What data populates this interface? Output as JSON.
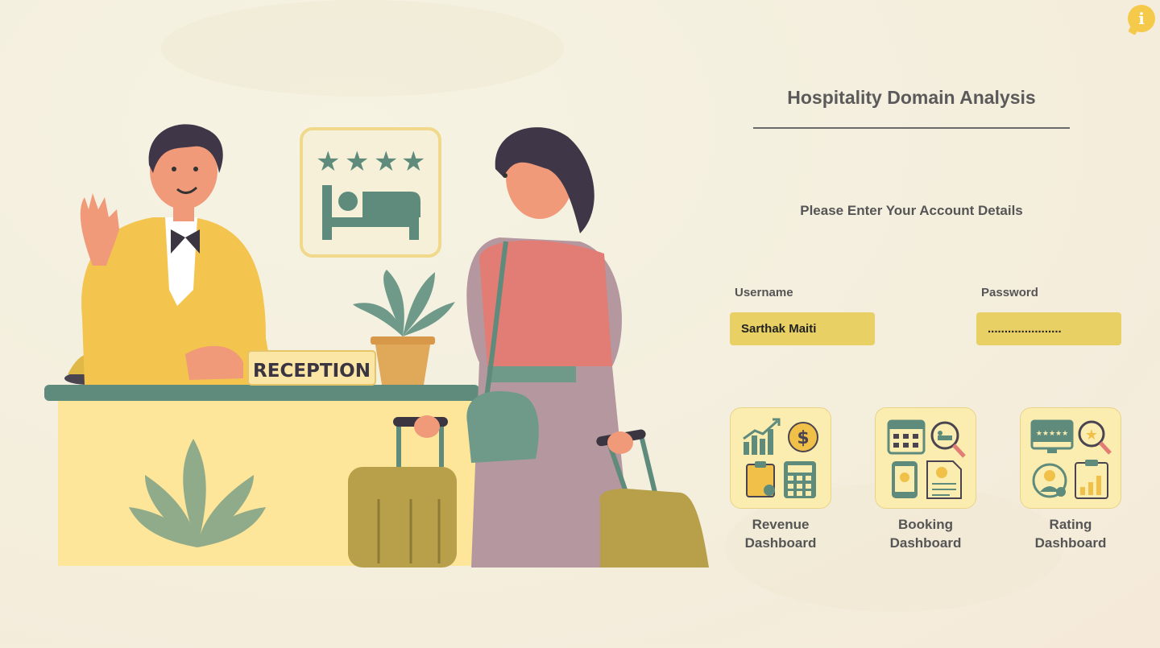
{
  "info": {
    "icon": "info-icon",
    "glyph": "i"
  },
  "illustration": {
    "sign_text": "RECEPTION"
  },
  "header": {
    "title": "Hospitality Domain Analysis",
    "subtitle": "Please Enter Your Account Details"
  },
  "form": {
    "username_label": "Username",
    "username_value": "Sarthak Maiti",
    "password_label": "Password",
    "password_value": "......................"
  },
  "dashboards": [
    {
      "line1": "Revenue",
      "line2": "Dashboard",
      "icon": "revenue-dashboard-icon"
    },
    {
      "line1": "Booking",
      "line2": "Dashboard",
      "icon": "booking-dashboard-icon"
    },
    {
      "line1": "Rating",
      "line2": "Dashboard",
      "icon": "rating-dashboard-icon"
    }
  ],
  "colors": {
    "accent": "#e8d064",
    "card_bg": "#fbedb0",
    "teal": "#5e8c7e",
    "info": "#f5c94a"
  }
}
